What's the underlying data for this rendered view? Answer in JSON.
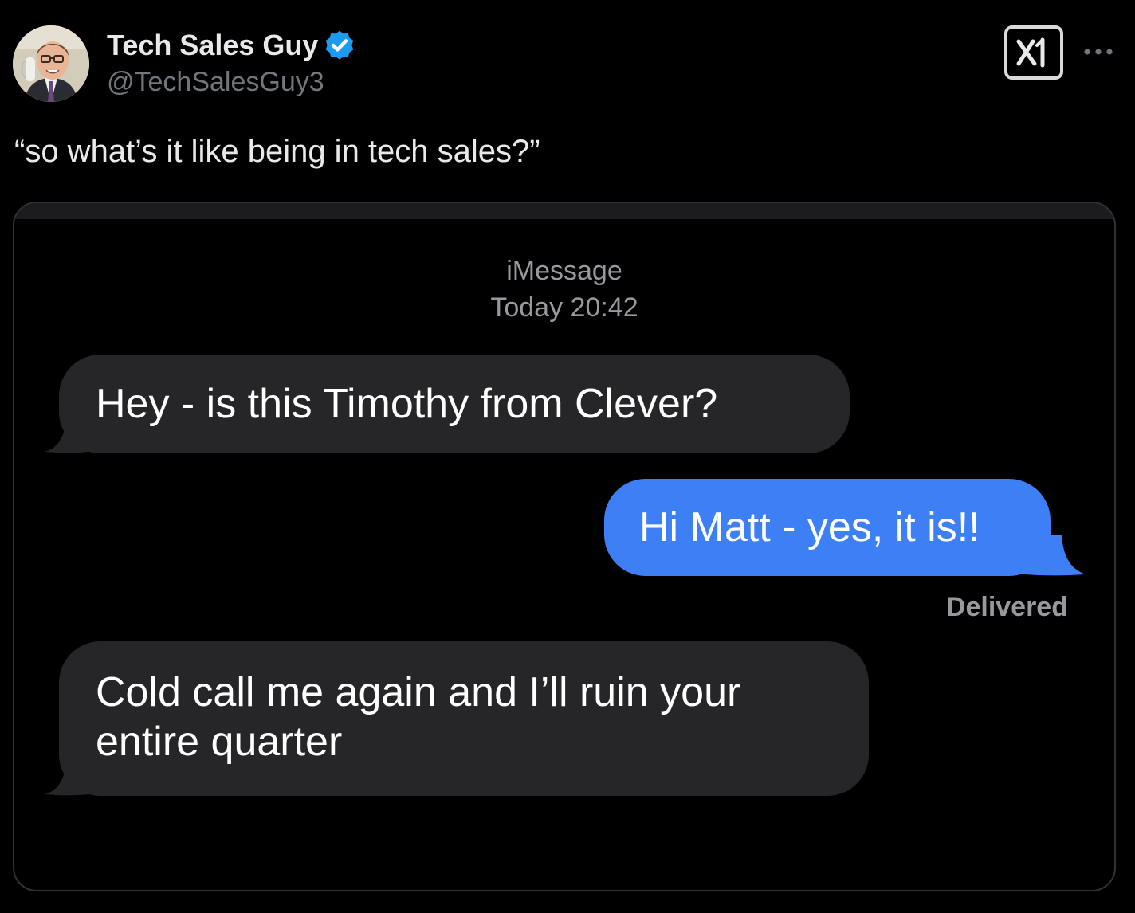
{
  "post": {
    "author_name": "Tech Sales Guy",
    "handle": "@TechSalesGuy3",
    "text": "“so what’s it like being in tech sales?”"
  },
  "icons": {
    "verified": "verified-badge-icon",
    "grok": "grok-icon",
    "more": "more-options-icon"
  },
  "colors": {
    "background": "#000000",
    "verified_blue": "#1d9bf0",
    "incoming_bubble": "#262629",
    "outgoing_bubble": "#3d80f5",
    "meta_text": "#98989d"
  },
  "conversation": {
    "service": "iMessage",
    "timestamp": "Today 20:42",
    "messages": [
      {
        "direction": "incoming",
        "text": "Hey - is this Timothy from Clever?"
      },
      {
        "direction": "outgoing",
        "text": "Hi Matt - yes, it is!!"
      },
      {
        "direction": "incoming",
        "text": "Cold call me again and I’ll ruin your entire quarter"
      }
    ],
    "status": "Delivered"
  }
}
